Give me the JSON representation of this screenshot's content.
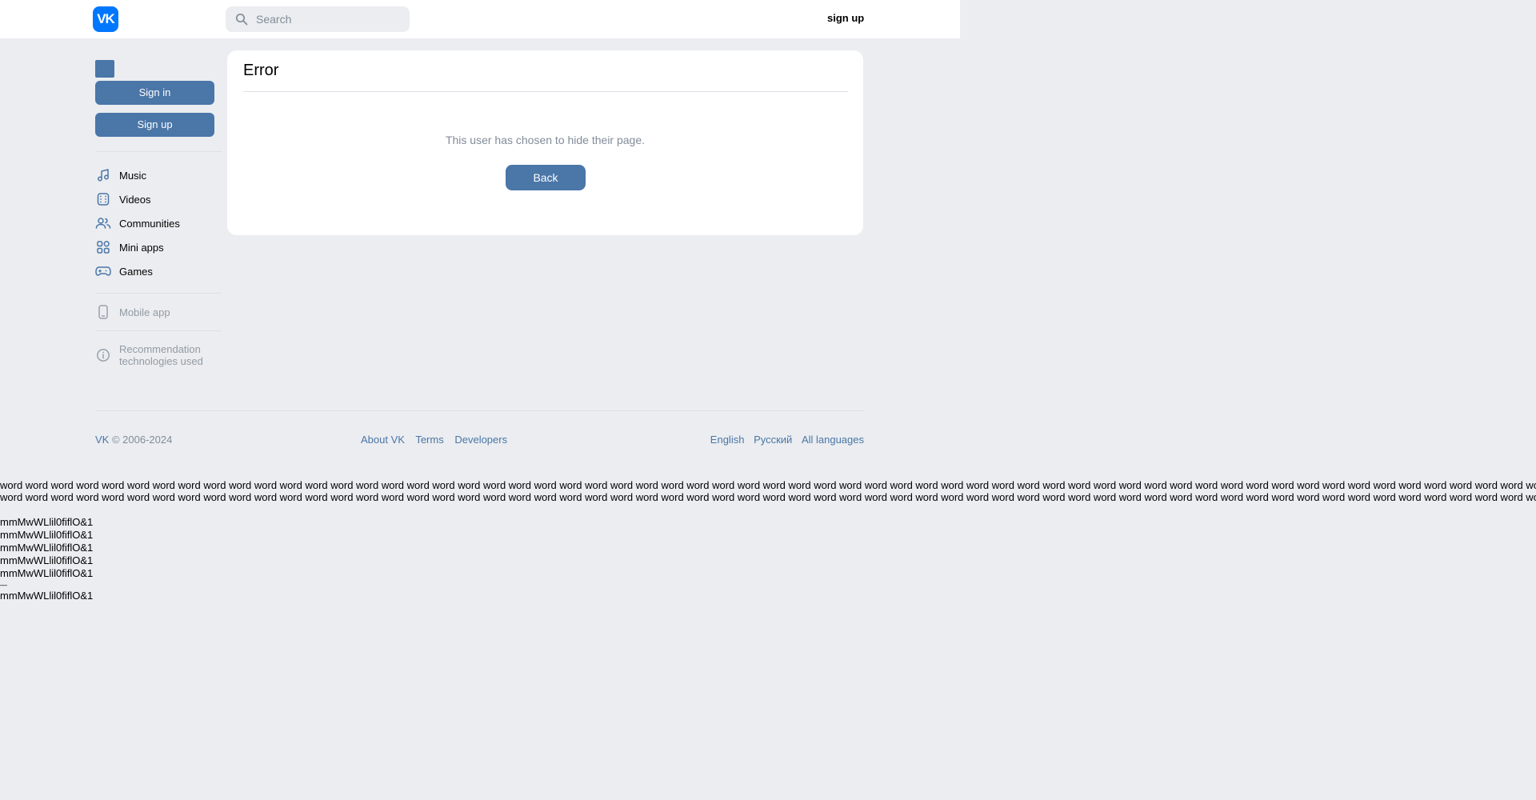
{
  "header": {
    "logo_text": "VK",
    "search_placeholder": "Search",
    "signup_label": "sign up"
  },
  "sidebar": {
    "signin_label": "Sign in",
    "signup_label": "Sign up",
    "items": [
      {
        "label": "Music",
        "icon": "music-icon"
      },
      {
        "label": "Videos",
        "icon": "video-icon"
      },
      {
        "label": "Communities",
        "icon": "users-icon"
      },
      {
        "label": "Mini apps",
        "icon": "apps-icon"
      },
      {
        "label": "Games",
        "icon": "gamepad-icon"
      }
    ],
    "mobile_app_label": "Mobile app",
    "recommendation_line1": "Recommendation",
    "recommendation_line2": "technologies used"
  },
  "card": {
    "title": "Error",
    "message": "This user has chosen to hide their page.",
    "back_label": "Back"
  },
  "footer": {
    "brand": "VK",
    "copyright": "© 2006-2024",
    "links": [
      "About VK",
      "Terms",
      "Developers"
    ],
    "languages": [
      "English",
      "Русский",
      "All languages"
    ]
  },
  "filler": {
    "word_line": "word word word word word word word word word word word word word word word word word word word word word word word word word word word word word word word word word word word word word word word word word word word word word word word word word word word word word word word word word word word word word word word word word",
    "glyph_line": "mmMwWLlil0fiflO&1",
    "dash": "—"
  },
  "colors": {
    "accent": "#4a76a8",
    "brand": "#0077ff",
    "background": "#ebedf0",
    "muted_text": "#818c99"
  }
}
